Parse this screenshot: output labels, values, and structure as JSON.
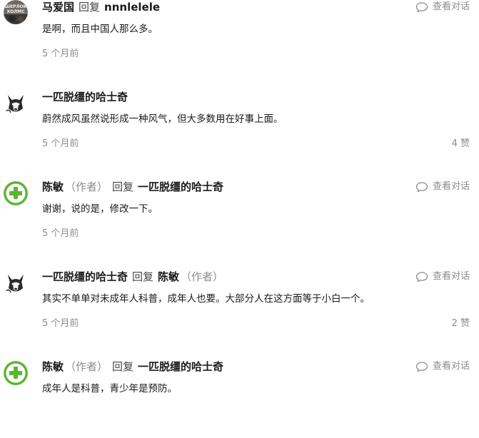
{
  "comments": [
    {
      "avatar_icon": "sherlock-avatar-icon",
      "avatar_text": "ШЕРЛОК ХОЛМС",
      "name": "马爱国",
      "is_author": false,
      "reply_word": "回复",
      "reply_to": "nnnlelele",
      "reply_to_author": false,
      "content": "是啊，而且中国人那么多。",
      "time": "5 个月前",
      "likes": "",
      "view_label": "查看对话"
    },
    {
      "avatar_icon": "husky-avatar-icon",
      "name": "一匹脱缰的哈士奇",
      "is_author": false,
      "reply_word": "",
      "reply_to": "",
      "reply_to_author": false,
      "content": "蔚然成风虽然说形成一种风气，但大多数用在好事上面。",
      "time": "5 个月前",
      "likes": "4 赞",
      "view_label": ""
    },
    {
      "avatar_icon": "green-cross-avatar-icon",
      "name": "陈敏",
      "is_author": true,
      "reply_word": "回复",
      "reply_to": "一匹脱缰的哈士奇",
      "reply_to_author": false,
      "content": "谢谢，说的是，修改一下。",
      "time": "5 个月前",
      "likes": "",
      "view_label": "查看对话"
    },
    {
      "avatar_icon": "husky-avatar-icon",
      "name": "一匹脱缰的哈士奇",
      "is_author": false,
      "reply_word": "回复",
      "reply_to": "陈敏",
      "reply_to_author": true,
      "content": "其实不单单对未成年人科普，成年人也要。大部分人在这方面等于小白一个。",
      "time": "5 个月前",
      "likes": "2 赞",
      "view_label": "查看对话"
    },
    {
      "avatar_icon": "green-cross-avatar-icon",
      "name": "陈敏",
      "is_author": true,
      "reply_word": "回复",
      "reply_to": "一匹脱缰的哈士奇",
      "reply_to_author": false,
      "content": "成年人是科普，青少年是预防。",
      "time": "",
      "likes": "",
      "view_label": "查看对话"
    }
  ],
  "author_tag": "（作者）",
  "colors": {
    "text": "#1a1a1a",
    "muted": "#8c8c8c",
    "green": "#5cb531"
  }
}
